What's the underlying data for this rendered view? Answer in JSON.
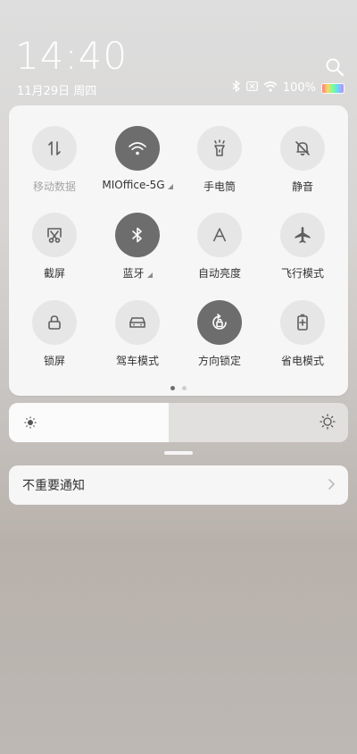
{
  "status": {
    "time": "14:40",
    "date": "11月29日 周四",
    "battery_text": "100%",
    "battery_level": 1.0
  },
  "tiles": [
    {
      "label": "移动数据",
      "icon": "mobile-data-icon",
      "active": false,
      "disabled": true,
      "signal": false
    },
    {
      "label": "MIOffice-5G",
      "icon": "wifi-icon",
      "active": true,
      "disabled": false,
      "signal": true
    },
    {
      "label": "手电筒",
      "icon": "flashlight-icon",
      "active": false,
      "disabled": false,
      "signal": false
    },
    {
      "label": "静音",
      "icon": "silent-bell-icon",
      "active": false,
      "disabled": false,
      "signal": false
    },
    {
      "label": "截屏",
      "icon": "screenshot-icon",
      "active": false,
      "disabled": false,
      "signal": false
    },
    {
      "label": "蓝牙",
      "icon": "bluetooth-icon",
      "active": true,
      "disabled": false,
      "signal": true
    },
    {
      "label": "自动亮度",
      "icon": "auto-brightness-icon",
      "active": false,
      "disabled": false,
      "signal": false
    },
    {
      "label": "飞行模式",
      "icon": "airplane-icon",
      "active": false,
      "disabled": false,
      "signal": false
    },
    {
      "label": "锁屏",
      "icon": "lock-icon",
      "active": false,
      "disabled": false,
      "signal": false
    },
    {
      "label": "驾车模式",
      "icon": "car-icon",
      "active": false,
      "disabled": false,
      "signal": false
    },
    {
      "label": "方向锁定",
      "icon": "rotation-lock-icon",
      "active": true,
      "disabled": false,
      "signal": false
    },
    {
      "label": "省电模式",
      "icon": "battery-saver-icon",
      "active": false,
      "disabled": false,
      "signal": false
    }
  ],
  "pager": {
    "pages": 2,
    "current": 1
  },
  "brightness": {
    "level": 0.47
  },
  "notification": {
    "label": "不重要通知"
  },
  "colors": {
    "active": "#6d6d6d",
    "inactive": "#e6e6e6",
    "panel": "#f6f6f6"
  }
}
